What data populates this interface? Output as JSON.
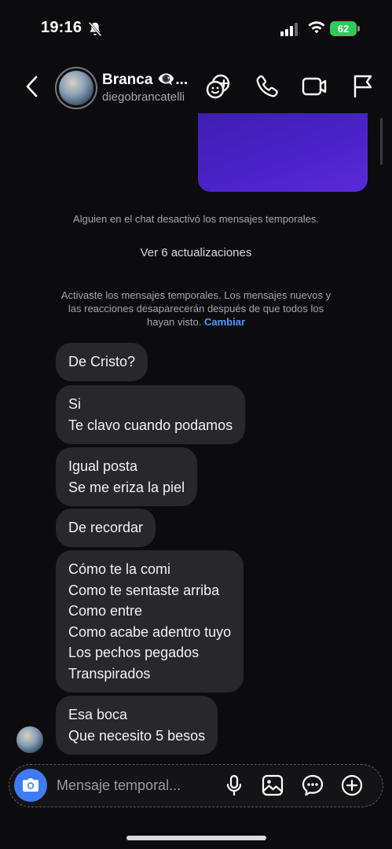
{
  "status_bar": {
    "time": "19:16",
    "battery": "62",
    "icons": [
      "bell-slash-icon",
      "signal-icon",
      "wifi-icon",
      "battery-icon"
    ]
  },
  "header": {
    "name": "Branca 👁‍🗨...",
    "username": "diegobrancatelli",
    "icons": [
      "back-icon",
      "effects-icon",
      "phone-icon",
      "video-icon",
      "flag-icon"
    ]
  },
  "chat": {
    "system_message_1": "Alguien en el chat desactivó los mensajes temporales.",
    "updates_link": "Ver 6 actualizaciones",
    "system_message_2_line1": "Activaste los mensajes temporales. Los mensajes nuevos y",
    "system_message_2_line2": "las reacciones desaparecerán después de que todos los",
    "system_message_2_line3": "hayan visto.",
    "system_message_2_link": "Cambiar",
    "messages": [
      {
        "lines": [
          "De Cristo?"
        ]
      },
      {
        "lines": [
          "Si",
          "Te clavo cuando podamos"
        ]
      },
      {
        "lines": [
          "Igual posta",
          "Se me eriza la piel"
        ]
      },
      {
        "lines": [
          "De recordar"
        ]
      },
      {
        "lines": [
          "Cómo te la comi",
          "Como te sentaste arriba",
          "Como entre",
          "Como acabe adentro tuyo",
          "Los pechos pegados",
          "Transpirados"
        ]
      },
      {
        "lines": [
          "Esa boca",
          "Que necesito 5 besos"
        ]
      }
    ]
  },
  "composer": {
    "placeholder": "Mensaje temporal...",
    "icons": [
      "camera-icon",
      "microphone-icon",
      "gallery-icon",
      "sticker-icon",
      "plus-icon"
    ]
  },
  "colors": {
    "background": "#0c0c0f",
    "bubble": "#27272c",
    "accent_blue": "#3f7bf5",
    "link_blue": "#4a9bff",
    "media_purple": "#4a23c8",
    "battery_green": "#34c759"
  }
}
